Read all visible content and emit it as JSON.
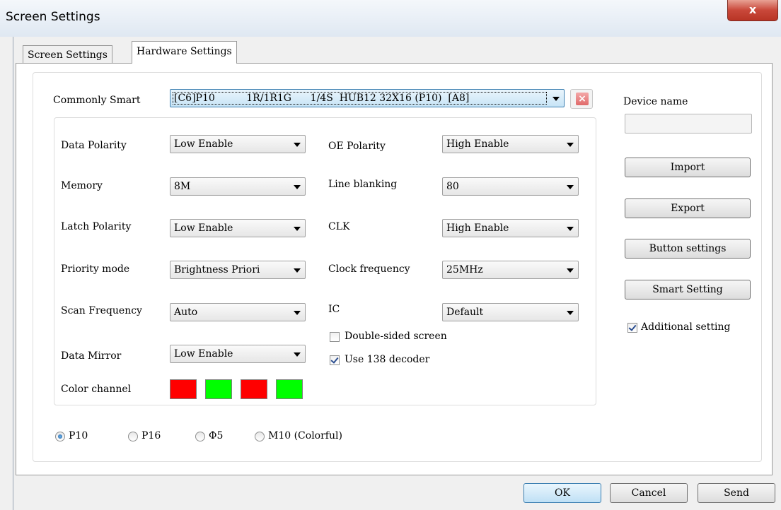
{
  "window": {
    "title": "Screen Settings",
    "close_glyph": "x"
  },
  "tabs": [
    {
      "label": "Screen Settings",
      "active": false
    },
    {
      "label": "Hardware Settings",
      "active": true
    }
  ],
  "commonly_smart": {
    "label": "Commonly Smart",
    "value": "[C6]P10          1R/1R1G      1/4S  HUB12 32X16 (P10)  [A8]"
  },
  "left_fields": [
    {
      "label": "Data Polarity",
      "value": "Low Enable"
    },
    {
      "label": "Memory",
      "value": "8M"
    },
    {
      "label": "Latch Polarity",
      "value": "Low Enable"
    },
    {
      "label": "Priority mode",
      "value": "Brightness Priori"
    },
    {
      "label": "Scan Frequency",
      "value": "Auto"
    },
    {
      "label": "Data Mirror",
      "value": "Low Enable"
    }
  ],
  "right_fields": [
    {
      "label": "OE Polarity",
      "value": "High Enable"
    },
    {
      "label": "Line blanking",
      "value": "80"
    },
    {
      "label": "CLK",
      "value": "High Enable"
    },
    {
      "label": "Clock frequency",
      "value": "25MHz"
    },
    {
      "label": "IC",
      "value": "Default"
    }
  ],
  "checkboxes": [
    {
      "label": "Double-sided screen",
      "checked": false
    },
    {
      "label": "Use 138 decoder",
      "checked": true
    }
  ],
  "color_channel": {
    "label": "Color channel",
    "colors": [
      "#ff0000",
      "#00ff00",
      "#ff0000",
      "#00ff00"
    ]
  },
  "side_panel": {
    "device_name_label": "Device name",
    "device_name_value": "",
    "import_label": "Import",
    "export_label": "Export",
    "button_settings_label": "Button settings",
    "smart_setting_label": "Smart Setting",
    "additional_setting_label": "Additional setting",
    "additional_setting_checked": true
  },
  "panel_types": [
    {
      "label": "P10",
      "selected": true
    },
    {
      "label": "P16",
      "selected": false
    },
    {
      "label": "Φ5",
      "selected": false
    },
    {
      "label": "M10 (Colorful)",
      "selected": false
    }
  ],
  "footer": {
    "ok_label": "OK",
    "cancel_label": "Cancel",
    "send_label": "Send"
  }
}
